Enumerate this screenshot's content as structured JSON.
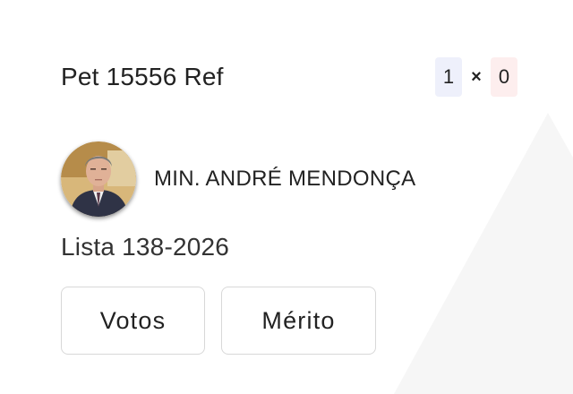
{
  "case": {
    "title": "Pet 15556 Ref"
  },
  "score": {
    "left": "1",
    "separator": "×",
    "right": "0",
    "left_bg": "#eef0fb",
    "right_bg": "#fdeeee"
  },
  "minister": {
    "name": "MIN. ANDRÉ MENDONÇA",
    "avatar_icon": "minister-portrait"
  },
  "list": {
    "label": "Lista 138-2026"
  },
  "actions": {
    "votes_label": "Votos",
    "merit_label": "Mérito"
  }
}
